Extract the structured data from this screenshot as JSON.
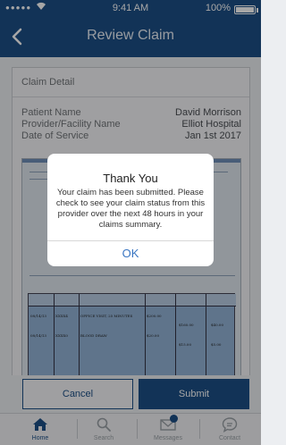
{
  "status_bar": {
    "time": "9:41 AM",
    "battery_percent": "100%",
    "battery_level": 1.0
  },
  "nav": {
    "title": "Review Claim"
  },
  "card": {
    "header": "Claim Detail",
    "fields": [
      {
        "label": "Patient Name",
        "value": "David Morrison"
      },
      {
        "label": "Provider/Facility Name",
        "value": "Elliot Hospital"
      },
      {
        "label": "Date of Service",
        "value": "Jan 1st 2017"
      }
    ]
  },
  "document": {
    "rows": [
      [
        "08/14/13",
        "XXXX4",
        "OFFICE VISIT, 25 MINUTES",
        "$200.00",
        "$160.00",
        "$40.00"
      ],
      [
        "08/14/13",
        "XXXX0",
        "BLOOD DRAW",
        "$20.00",
        "$15.00",
        "$5.00"
      ]
    ]
  },
  "modal": {
    "title": "Thank You",
    "message": "Your claim has been submitted. Please check to see your claim status from this provider over the next 48 hours in your claims summary.",
    "ok_label": "OK"
  },
  "actions": {
    "cancel_label": "Cancel",
    "submit_label": "Submit"
  },
  "tabs": [
    {
      "label": "Home",
      "icon": "home-icon",
      "active": true
    },
    {
      "label": "Search",
      "icon": "search-icon",
      "active": false
    },
    {
      "label": "Messages",
      "icon": "messages-icon",
      "active": false
    },
    {
      "label": "Contact",
      "icon": "chat-icon",
      "active": false
    }
  ],
  "colors": {
    "primary": "#1d4f86",
    "link": "#3a76c2",
    "background": "#eceef1"
  }
}
